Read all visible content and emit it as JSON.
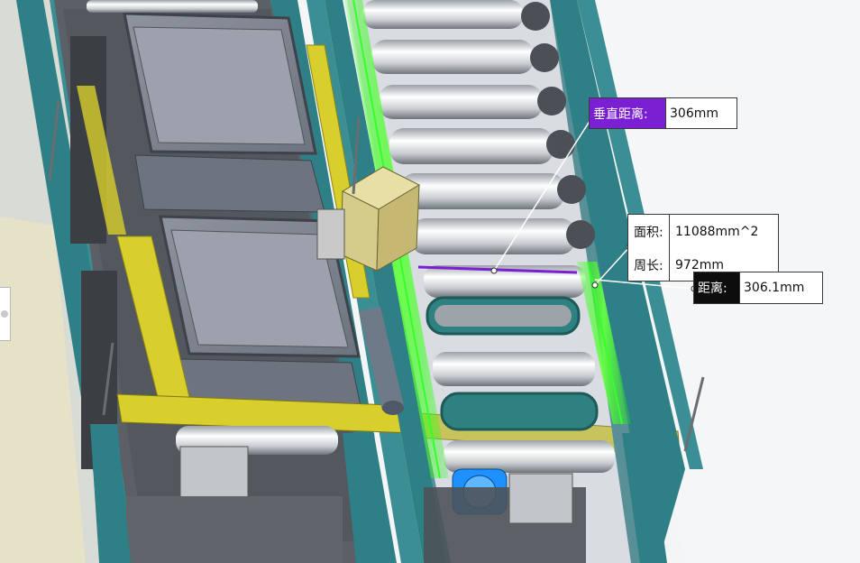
{
  "callouts": {
    "vertical_distance": {
      "label": "垂直距离:",
      "value": "306mm"
    },
    "area": {
      "label": "面积:",
      "value": "11088mm^2"
    },
    "perimeter": {
      "label": "周长:",
      "value": "972mm"
    },
    "distance": {
      "label": "距离:",
      "value": "306.1mm"
    }
  },
  "colors": {
    "frame_teal": "#2f7f86",
    "rail_yellow": "#d9cf2c",
    "selection_green": "#35ff2a",
    "measure_purple": "#7a1fd1",
    "motor_blue": "#1e90ff"
  }
}
